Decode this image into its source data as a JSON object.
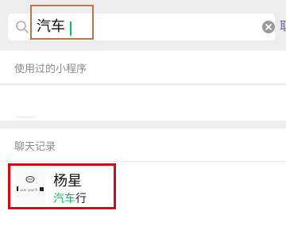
{
  "search": {
    "query": "汽车",
    "cancel_label": "取"
  },
  "sections": {
    "mini_programs_header": "使用过的小程序",
    "chat_history_header": "聊天记录"
  },
  "chat_results": [
    {
      "name": "杨星",
      "match_prefix": "",
      "match_highlight": "汽车",
      "match_suffix": "行",
      "avatar_caption": "user your'll"
    }
  ],
  "colors": {
    "highlight": "#07c160",
    "annotation_orange": "#b8774a",
    "annotation_red": "#d10a16",
    "link_blue": "#576b95"
  },
  "icons": {
    "search": "search-icon",
    "clear": "clear-icon"
  }
}
